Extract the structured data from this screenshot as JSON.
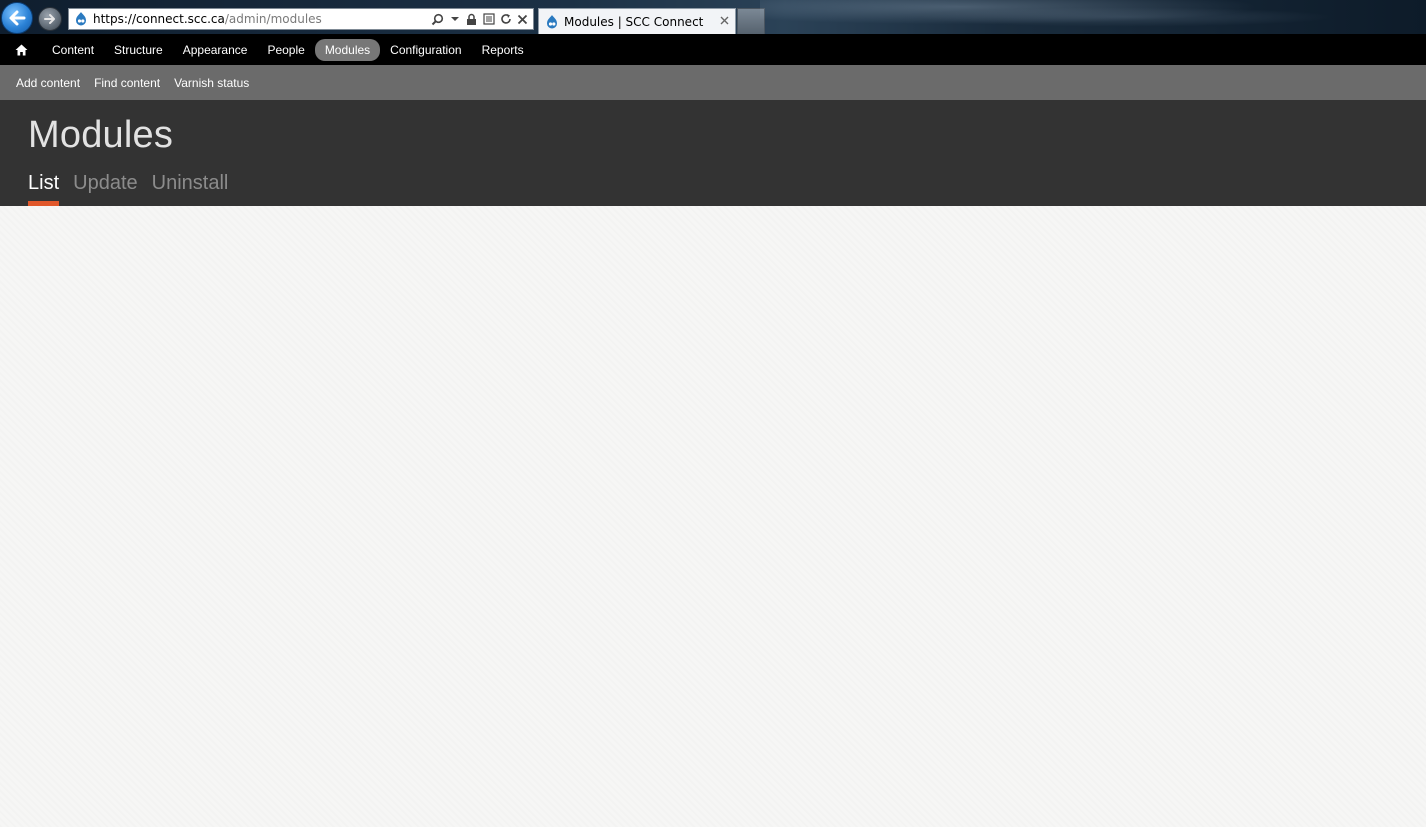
{
  "browser": {
    "url_protocol": "https://",
    "url_domain": "connect.scc.ca",
    "url_path": "/admin/modules",
    "tab_title": "Modules | SCC Connect",
    "icons": [
      "back-arrow-icon",
      "forward-arrow-icon",
      "drupal-favicon-icon",
      "search-icon",
      "lock-icon",
      "compatibility-icon",
      "refresh-icon",
      "stop-icon",
      "close-icon"
    ]
  },
  "toolbar": {
    "home_icon": "home-icon",
    "items": [
      {
        "label": "Content"
      },
      {
        "label": "Structure"
      },
      {
        "label": "Appearance"
      },
      {
        "label": "People"
      },
      {
        "label": "Modules",
        "active": true
      },
      {
        "label": "Configuration"
      },
      {
        "label": "Reports"
      }
    ]
  },
  "shortcuts": {
    "items": [
      {
        "label": "Add content"
      },
      {
        "label": "Find content"
      },
      {
        "label": "Varnish status"
      }
    ]
  },
  "page": {
    "title": "Modules",
    "tabs": [
      {
        "label": "List",
        "active": true
      },
      {
        "label": "Update"
      },
      {
        "label": "Uninstall"
      }
    ]
  },
  "colors": {
    "toolbar_bg": "#000000",
    "active_pill": "#777777",
    "shortcuts_bg": "#6b6b6b",
    "header_bg": "#333333",
    "active_tab_underline": "#e0572a",
    "content_bg": "#f6f6f5"
  }
}
